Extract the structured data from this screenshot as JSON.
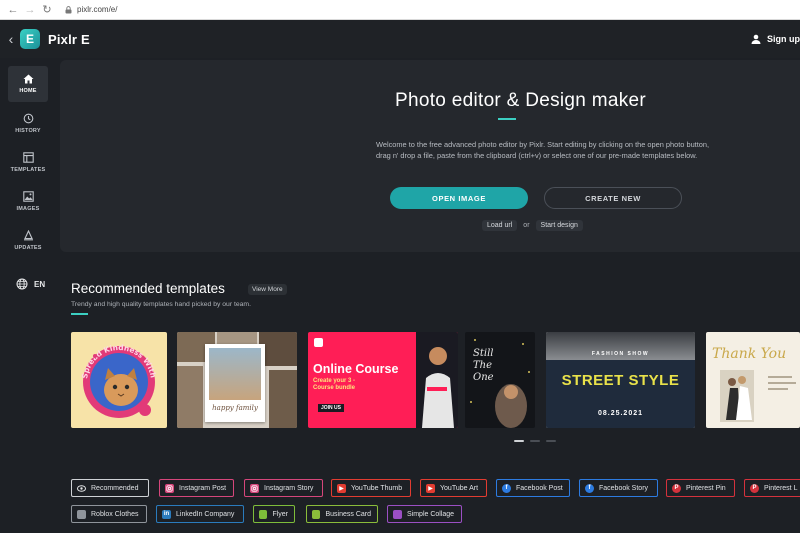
{
  "browser": {
    "url": "pixlr.com/e/"
  },
  "app": {
    "title": "Pixlr E",
    "logo_letter": "E",
    "signup_label": "Sign up"
  },
  "sidebar": {
    "items": [
      {
        "label": "HOME",
        "icon": "home-icon"
      },
      {
        "label": "HISTORY",
        "icon": "history-icon"
      },
      {
        "label": "TEMPLATES",
        "icon": "templates-icon"
      },
      {
        "label": "IMAGES",
        "icon": "images-icon"
      },
      {
        "label": "UPDATES",
        "icon": "updates-icon"
      }
    ],
    "language": "EN"
  },
  "hero": {
    "title": "Photo editor & Design maker",
    "description": "Welcome to the free advanced photo editor by Pixlr. Start editing by clicking on the open photo button, drag n' drop a file, paste from the clipboard (ctrl+v) or select one of our pre-made templates below.",
    "open_label": "OPEN IMAGE",
    "create_label": "CREATE NEW",
    "load_url": "Load url",
    "or": "or",
    "start_design": "Start design"
  },
  "recommended": {
    "title": "Recommended templates",
    "view_more": "View More",
    "subtitle": "Trendy and high quality templates hand picked by our team."
  },
  "templates": [
    {
      "text": "Spread Kindness With Love",
      "accent": "#e23a78"
    },
    {
      "text": "happy family",
      "accent": "#8d6b4f"
    },
    {
      "text": "Online Course",
      "sub": "Create your 3 - Course bundle",
      "cta": "JOIN US",
      "accent": "#ff1e56"
    },
    {
      "text": "Still The One",
      "accent": "#d7c35a"
    },
    {
      "text": "STREET STYLE",
      "sub": "FASHION SHOW",
      "date": "08.25.2021",
      "accent": "#e9e24a"
    },
    {
      "text": "Thank You",
      "accent": "#c9a84a"
    }
  ],
  "categories": [
    {
      "label": "Recommended",
      "color": "#cfd2d6",
      "icon": "eye-icon"
    },
    {
      "label": "Instagram Post",
      "color": "#d6467b",
      "icon": "instagram-icon"
    },
    {
      "label": "Instagram Story",
      "color": "#d6467b",
      "icon": "instagram-icon"
    },
    {
      "label": "YouTube Thumb",
      "color": "#e23c31",
      "icon": "youtube-icon"
    },
    {
      "label": "YouTube Art",
      "color": "#e23c31",
      "icon": "youtube-icon"
    },
    {
      "label": "Facebook Post",
      "color": "#2d7be0",
      "icon": "facebook-icon"
    },
    {
      "label": "Facebook Story",
      "color": "#2d7be0",
      "icon": "facebook-icon"
    },
    {
      "label": "Pinterest Pin",
      "color": "#d4323d",
      "icon": "pinterest-icon"
    },
    {
      "label": "Pinterest L",
      "color": "#d4323d",
      "icon": "pinterest-icon"
    },
    {
      "label": "Roblox Clothes",
      "color": "#8f949b",
      "icon": "roblox-icon"
    },
    {
      "label": "LinkedIn Company",
      "color": "#2a7bbd",
      "icon": "linkedin-icon"
    },
    {
      "label": "Flyer",
      "color": "#7ebd3a",
      "icon": "flyer-icon"
    },
    {
      "label": "Business Card",
      "color": "#8bbd3a",
      "icon": "business-card-icon"
    },
    {
      "label": "Simple Collage",
      "color": "#9b4fc4",
      "icon": "collage-icon"
    }
  ]
}
